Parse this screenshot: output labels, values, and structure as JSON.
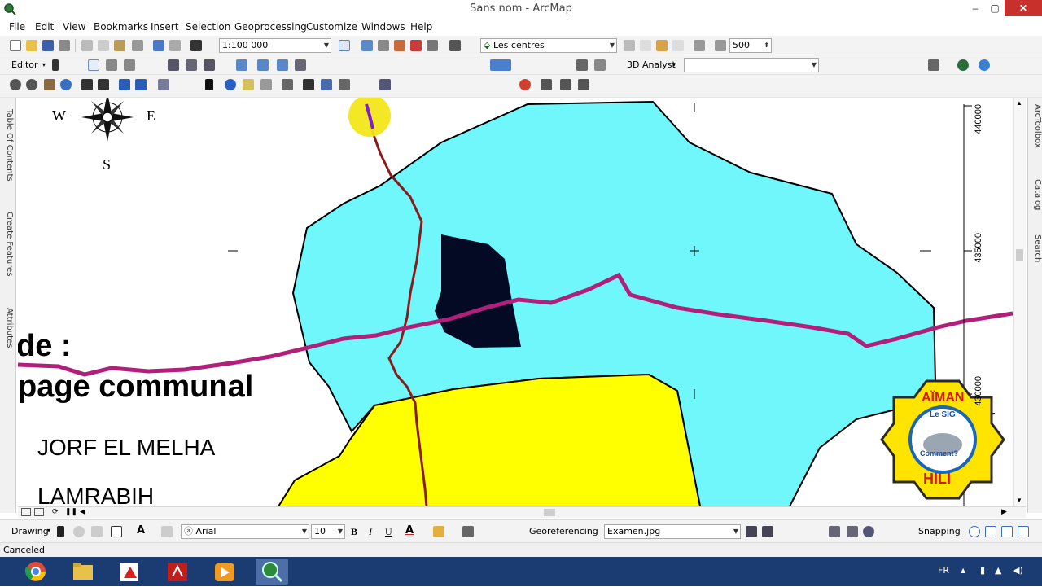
{
  "window": {
    "title": "Sans nom - ArcMap",
    "minimize": "–",
    "maximize": "▢",
    "close": "✕"
  },
  "menu": [
    "File",
    "Edit",
    "View",
    "Bookmarks",
    "Insert",
    "Selection",
    "Geoprocessing",
    "Customize",
    "Windows",
    "Help"
  ],
  "standard_toolbar": {
    "scale": "1:100 000",
    "layer_combo": "Les centres",
    "spin_value": "500"
  },
  "editor_toolbar": {
    "editor_label": "Editor",
    "analyst_label": "3D Analyst",
    "analyst_combo": ""
  },
  "left_tabs": [
    "Table Of Contents",
    "Create Features",
    "Attributes"
  ],
  "right_tabs": [
    "ArcToolbox",
    "Catalog",
    "Search"
  ],
  "map": {
    "compass": {
      "west": "W",
      "east": "E",
      "south": "S"
    },
    "legend_title_fragment": "de :",
    "legend_subtitle_fragment": "page communal",
    "legend_items": [
      "JORF EL MELHA",
      "LAMRABIH"
    ],
    "coord_labels": [
      "440000",
      "435000",
      "430000"
    ],
    "logo": {
      "top": "AÏMAN",
      "bottom": "HILI",
      "center_line1": "Le SIG",
      "center_line2": "Comment?"
    },
    "colors": {
      "commune_cyan": "#6ff7fb",
      "commune_yellow": "#ffff00",
      "road_magenta": "#b0207a",
      "river_red": "#8b1a1a",
      "urban_dark": "#050a24",
      "highlight": "#f2e61a"
    }
  },
  "drawing_toolbar": {
    "drawing_label": "Drawing",
    "font": "Arial",
    "font_size": "10",
    "bold": "B",
    "italic": "I",
    "underline": "U",
    "text_tool": "A",
    "georef_label": "Georeferencing",
    "georef_layer": "Examen.jpg",
    "snapping_label": "Snapping"
  },
  "status": {
    "message": "Canceled"
  },
  "taskbar": {
    "language": "FR"
  }
}
